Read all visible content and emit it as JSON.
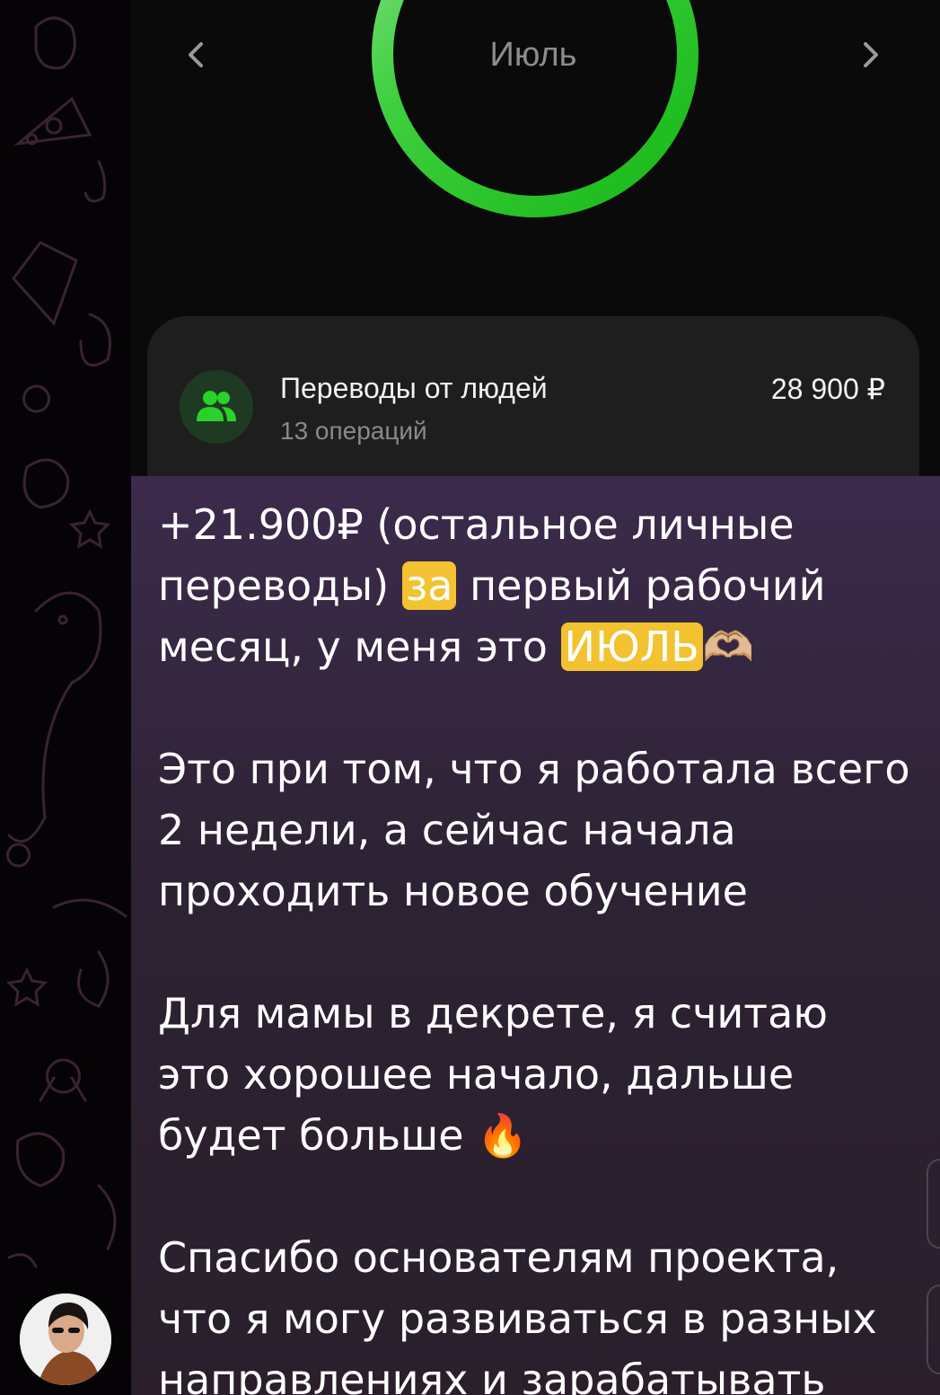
{
  "photo": {
    "month": "Июль",
    "nav_prev_icon": "chevron-left-icon",
    "nav_next_icon": "chevron-right-icon",
    "ring_color": "#1ec01e",
    "category": {
      "icon": "people-icon",
      "title": "Переводы от людей",
      "subtitle": "13 операций",
      "amount": "28 900 ₽"
    }
  },
  "message": {
    "line1_a": "+21.900₽ (остальное личные переводы) ",
    "line1_hl1": "за",
    "line1_b": " первый рабочий месяц, у меня это ",
    "line1_hl2": "ИЮЛЬ",
    "line1_emoji": "🫶🏼",
    "para2": "Это при том, что я работала всего 2 недели, а сейчас начала проходить новое обучение",
    "para3_text": "Для мамы в декрете, я считаю это хорошее начало, дальше будет больше ",
    "para3_emoji": "🔥",
    "para4": "Спасибо основателям проекта, что я могу развиваться в разных направлениях и зарабатывать"
  },
  "colors": {
    "highlight": "#f2c230",
    "bubble_top": "#3c2b4c",
    "bubble_bottom": "#2a1f2b"
  }
}
